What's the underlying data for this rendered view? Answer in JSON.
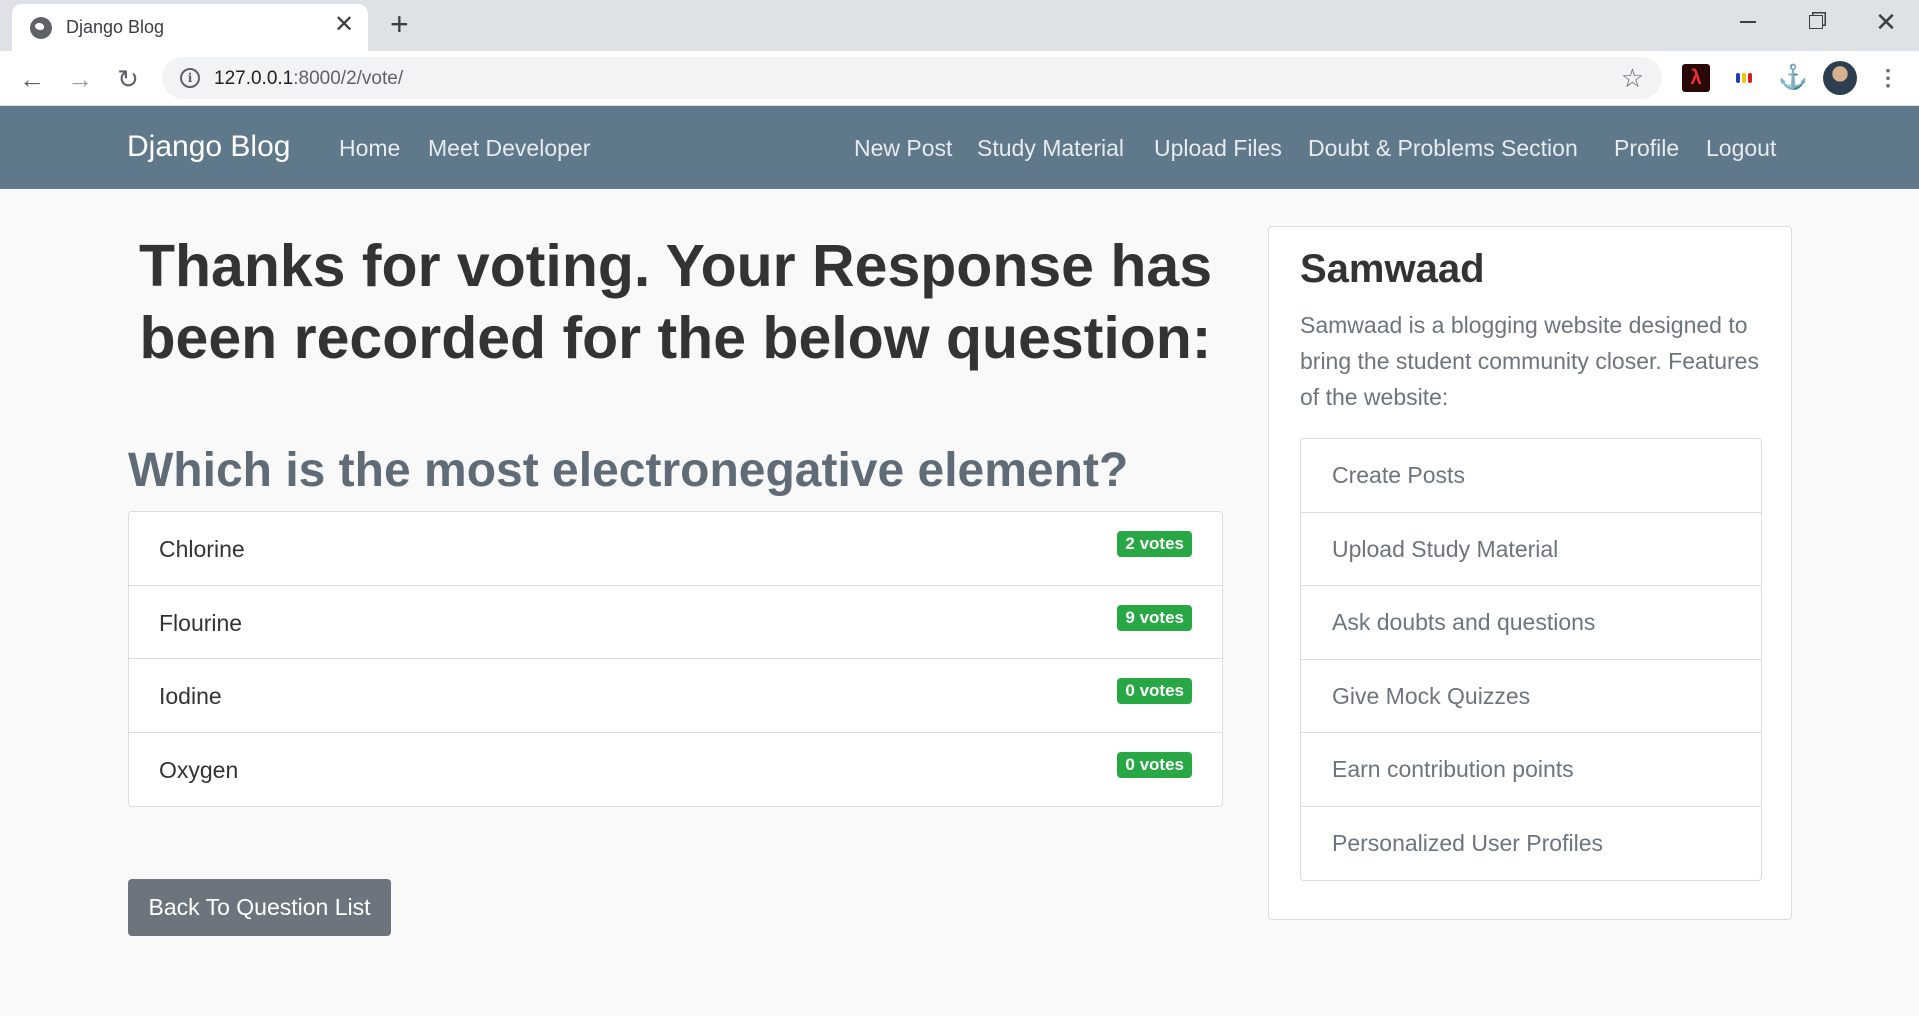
{
  "browser": {
    "tab_title": "Django Blog",
    "new_tab_symbol": "+",
    "close_symbol": "✕",
    "url_host": "127.0.0.1",
    "url_rest": ":8000/2/vote/"
  },
  "nav": {
    "brand": "Django Blog",
    "left_links": [
      "Home",
      "Meet Developer"
    ],
    "right_links": [
      "New Post",
      "Study Material",
      "Upload Files",
      "Doubt & Problems Section",
      "Profile",
      "Logout"
    ]
  },
  "main": {
    "heading": "Thanks for voting. Your Response has been recorded for the below question:",
    "question": "Which is the most electronegative element?",
    "choices": [
      {
        "text": "Chlorine",
        "votes": "2 votes"
      },
      {
        "text": "Flourine",
        "votes": "9 votes"
      },
      {
        "text": "Iodine",
        "votes": "0 votes"
      },
      {
        "text": "Oxygen",
        "votes": "0 votes"
      }
    ],
    "back_button": "Back To Question List"
  },
  "sidebar": {
    "title": "Samwaad",
    "description": "Samwaad is a blogging website designed to bring the student community closer. Features of the website:",
    "features": [
      "Create Posts",
      "Upload Study Material",
      "Ask doubts and questions",
      "Give Mock Quizzes",
      "Earn contribution points",
      "Personalized User Profiles"
    ]
  },
  "colors": {
    "navbar": "#5f788a",
    "badge": "#28a745",
    "button": "#6c757d"
  }
}
